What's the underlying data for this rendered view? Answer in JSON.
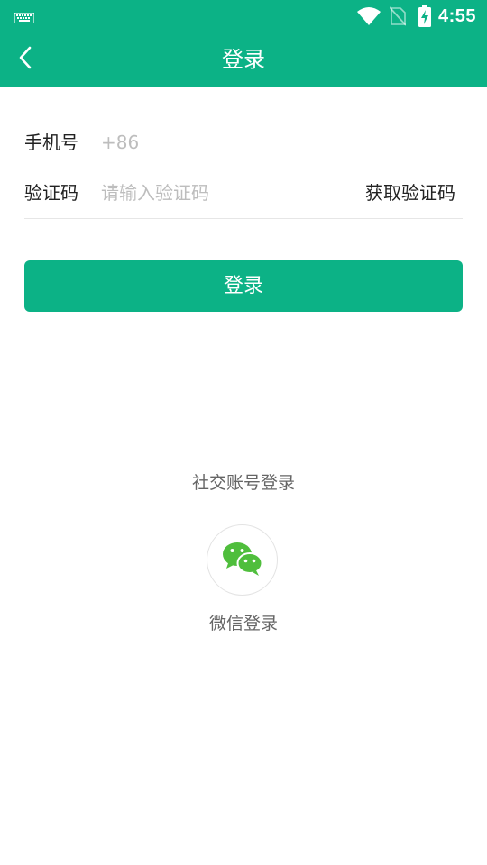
{
  "status_bar": {
    "time": "4:55"
  },
  "app_bar": {
    "title": "登录"
  },
  "form": {
    "phone": {
      "label": "手机号",
      "placeholder": "+86"
    },
    "code": {
      "label": "验证码",
      "placeholder": "请输入验证码",
      "action_label": "获取验证码"
    },
    "submit_label": "登录"
  },
  "social": {
    "title": "社交账号登录",
    "wechat_label": "微信登录"
  },
  "colors": {
    "primary": "#0cb286",
    "wechat": "#4fbe3c"
  },
  "icons": [
    "keyboard-icon",
    "wifi-icon",
    "no-sim-icon",
    "battery-charging-icon",
    "back-arrow-icon",
    "wechat-icon"
  ]
}
